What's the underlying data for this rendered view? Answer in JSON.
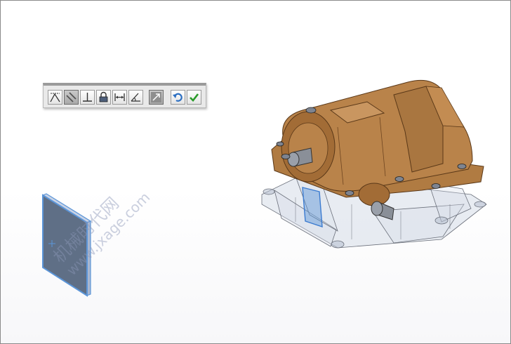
{
  "toolbar": {
    "buttons": [
      {
        "id": "coincident",
        "icon": "coincident-icon"
      },
      {
        "id": "parallel",
        "icon": "parallel-icon"
      },
      {
        "id": "perpendicular",
        "icon": "perpendicular-icon"
      },
      {
        "id": "lock",
        "icon": "lock-icon"
      },
      {
        "id": "distance",
        "icon": "distance-icon"
      },
      {
        "id": "angle",
        "icon": "angle-icon"
      },
      {
        "id": "flip",
        "icon": "flip-alignment-icon"
      },
      {
        "id": "undo",
        "icon": "undo-icon"
      },
      {
        "id": "ok",
        "icon": "checkmark-icon"
      }
    ],
    "active": "parallel"
  },
  "colors": {
    "housing": "#b9834a",
    "housing_dark": "#7a4f23",
    "base_transparent": "#d6dde8",
    "selection_blue": "#5b95d8",
    "viewport_border": "#8a8a8a"
  },
  "watermark": {
    "line1": "机械时代网",
    "line2": "www.jxage.com"
  }
}
